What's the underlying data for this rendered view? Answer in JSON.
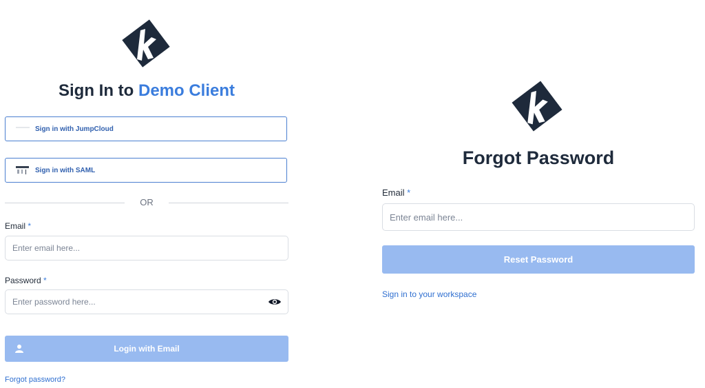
{
  "signin": {
    "title_prefix": "Sign In to",
    "title_client": "Demo Client",
    "sso_jumpcloud_label": "Sign in with JumpCloud",
    "sso_saml_label": "Sign in with SAML",
    "divider_text": "OR",
    "email_label": "Email",
    "email_placeholder": "Enter email here...",
    "password_label": "Password",
    "password_placeholder": "Enter password here...",
    "required_mark": "*",
    "login_button": "Login with Email",
    "forgot_link": "Forgot password?"
  },
  "forgot": {
    "title": "Forgot Password",
    "email_label": "Email",
    "required_mark": "*",
    "email_placeholder": "Enter email here...",
    "reset_button": "Reset Password",
    "workspace_link": "Sign in to your workspace"
  },
  "colors": {
    "accent": "#3b7ddd",
    "button_disabled": "#98baf0",
    "logo": "#1e2a3b"
  },
  "icons": {
    "logo": "k-brand-logo-icon",
    "password_toggle": "eye-icon",
    "login": "user-icon",
    "jumpcloud": "jumpcloud-icon",
    "saml": "saml-icon"
  }
}
